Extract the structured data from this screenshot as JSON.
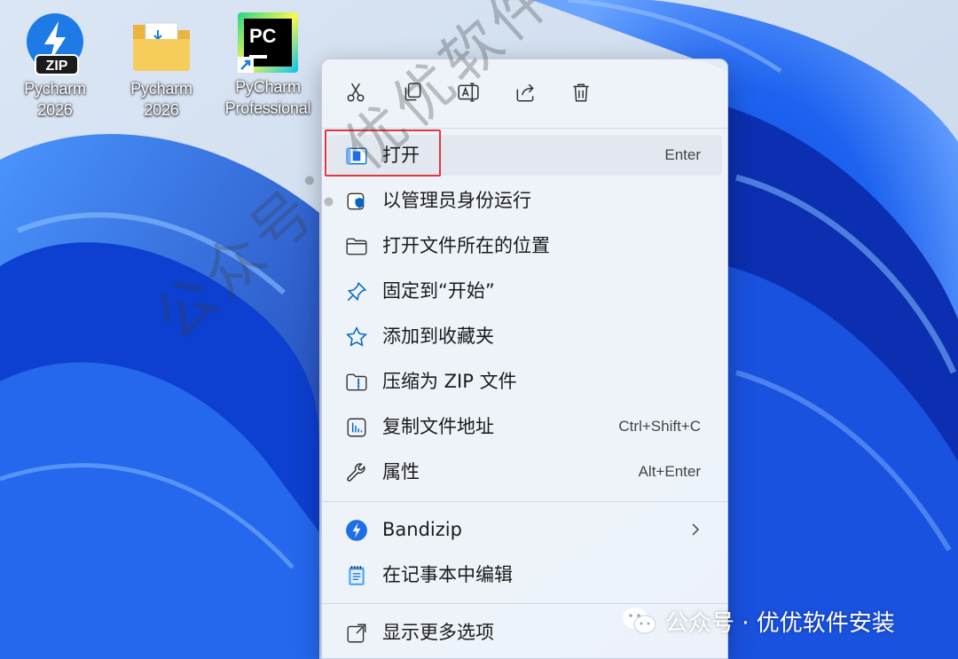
{
  "desktop": {
    "icons": [
      {
        "line1": "Pycharm",
        "line2": "2026",
        "badge": "ZIP",
        "icon": "bandizip-archive-icon"
      },
      {
        "line1": "Pycharm",
        "line2": "2026",
        "icon": "folder-icon"
      },
      {
        "line1": "PyCharm",
        "line2": "Professional",
        "badge": "PC",
        "icon": "pycharm-shortcut-icon"
      }
    ]
  },
  "context_menu": {
    "quick_actions": [
      "cut-icon",
      "copy-icon",
      "rename-icon",
      "share-icon",
      "delete-icon"
    ],
    "items": [
      {
        "label": "打开",
        "shortcut": "Enter",
        "icon": "open-app-icon"
      },
      {
        "label": "以管理员身份运行",
        "icon": "admin-shield-icon"
      },
      {
        "label": "打开文件所在的位置",
        "icon": "folder-outline-icon"
      },
      {
        "label": "固定到“开始”",
        "icon": "pin-icon"
      },
      {
        "label": "添加到收藏夹",
        "icon": "star-icon"
      },
      {
        "label": "压缩为 ZIP 文件",
        "icon": "zip-folder-icon"
      },
      {
        "label": "复制文件地址",
        "shortcut": "Ctrl+Shift+C",
        "icon": "copy-path-icon"
      },
      {
        "label": "属性",
        "shortcut": "Alt+Enter",
        "icon": "wrench-icon"
      },
      {
        "label": "Bandizip",
        "icon": "bandizip-icon",
        "has_submenu": true
      },
      {
        "label": "在记事本中编辑",
        "icon": "notepad-icon"
      },
      {
        "label": "显示更多选项",
        "icon": "more-options-icon"
      }
    ]
  },
  "watermark": {
    "diagonal": "公众号：优优软件安装",
    "bottom": "公众号 · 优优软件安装"
  },
  "colors": {
    "accent": "#0067c0",
    "highlight_border": "#e0383e"
  }
}
